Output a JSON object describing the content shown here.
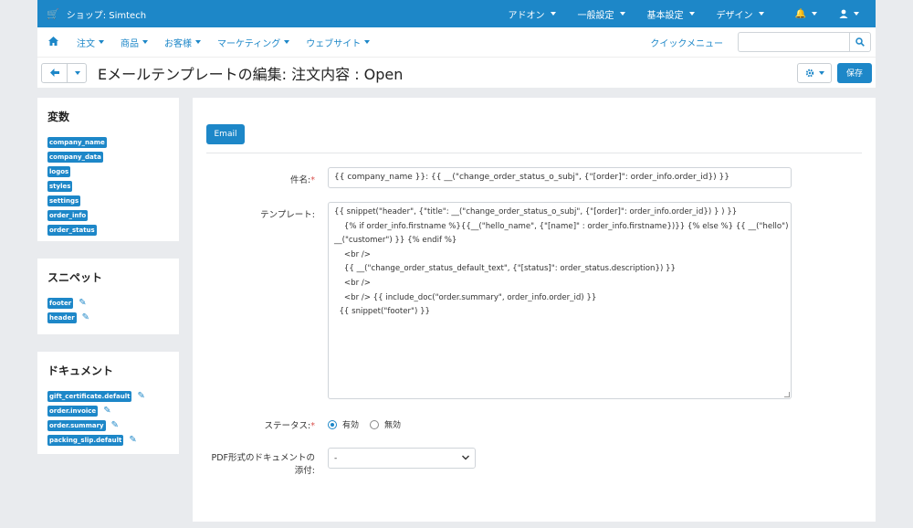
{
  "topbar": {
    "shop_name": "ショップ: Simtech",
    "menus": [
      "アドオン",
      "一般設定",
      "基本設定",
      "デザイン"
    ]
  },
  "navbar": {
    "items": [
      "注文",
      "商品",
      "お客様",
      "マーケティング",
      "ウェブサイト"
    ],
    "quick_menu": "クイックメニュー",
    "search_value": ""
  },
  "title": {
    "text": "Eメールテンプレートの編集: 注文内容 : Open",
    "save": "保存"
  },
  "variables": {
    "heading": "変数",
    "items": [
      "company_name",
      "company_data",
      "logos",
      "styles",
      "settings",
      "order_info",
      "order_status"
    ]
  },
  "snippets": {
    "heading": "スニペット",
    "items": [
      "footer",
      "header"
    ]
  },
  "documents": {
    "heading": "ドキュメント",
    "items": [
      "gift_certificate.default",
      "order.invoice",
      "order.summary",
      "packing_slip.default"
    ]
  },
  "main": {
    "tab": "Email",
    "subject_label": "件名:",
    "subject_value": "{{ company_name }}: {{ __(\"change_order_status_o_subj\", {\"[order]\": order_info.order_id}) }}",
    "template_label": "テンプレート:",
    "template_lines": [
      "{{ snippet(\"header\", {\"title\": __(\"change_order_status_o_subj\", {\"[order]\": order_info.order_id}) } ) }}",
      "    {% if order_info.firstname %}{{__(\"hello_name\", {\"[name]\" : order_info.firstname})}} {% else %} {{ __(\"hello\") }},  {{",
      "__(\"customer\") }} {% endif %}",
      "    <br />",
      "    {{ __(\"change_order_status_default_text\", {\"[status]\": order_status.description}) }}",
      "    <br />",
      "    <br /> {{ include_doc(\"order.summary\", order_info.order_id) }}",
      "  {{ snippet(\"footer\") }}"
    ],
    "status_label": "ステータス:",
    "status_on": "有効",
    "status_off": "無効",
    "pdf_label_1": "PDF形式のドキュメントの",
    "pdf_label_2": "添付:",
    "pdf_value": "-"
  }
}
